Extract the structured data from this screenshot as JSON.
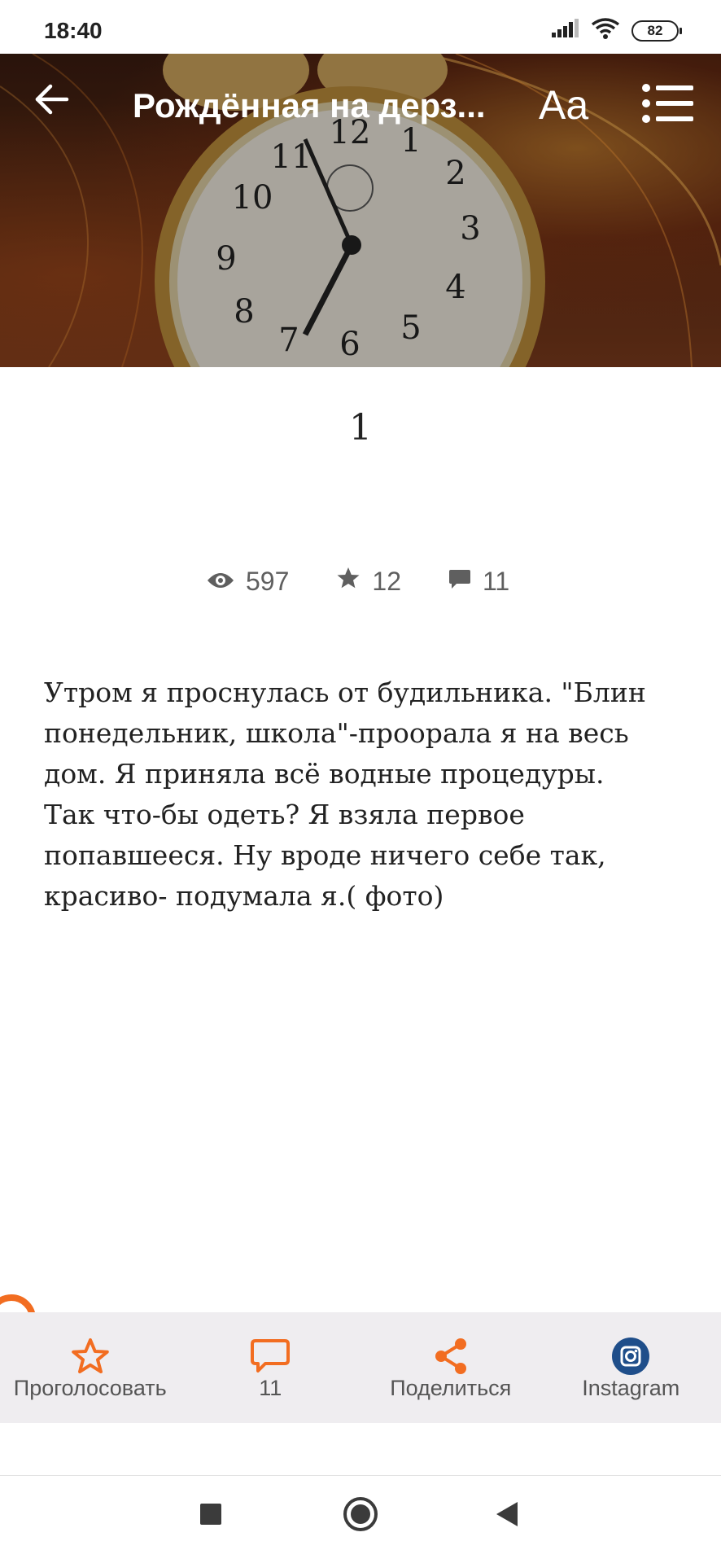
{
  "status_bar": {
    "time": "18:40",
    "battery": "82",
    "icons": [
      "signal-icon",
      "wifi-icon",
      "battery-icon"
    ]
  },
  "header": {
    "title": "Рождённая на дерз...",
    "font_button": "Aa",
    "background": "alarm-clock-artwork",
    "icons": [
      "back-arrow-icon",
      "table-of-contents-icon"
    ]
  },
  "chapter": {
    "title": "1",
    "stats": {
      "views": "597",
      "votes": "12",
      "comments": "11"
    },
    "body": "Утром я проснулась от будильника. \"Блин понедельник, школа\"-проорала я на весь дом. Я приняла всё водные процедуры. Так что-бы одеть? Я взяла первое попавшееся. Ну вроде ничего себе так, красиво- подумала я.( фото)"
  },
  "actions": {
    "vote": "Проголосовать",
    "comments": "11",
    "share": "Поделиться",
    "instagram": "Instagram"
  },
  "colors": {
    "accent": "#f26d21",
    "instagram": "#1f4e8a",
    "action_bar": "#efedf0"
  }
}
